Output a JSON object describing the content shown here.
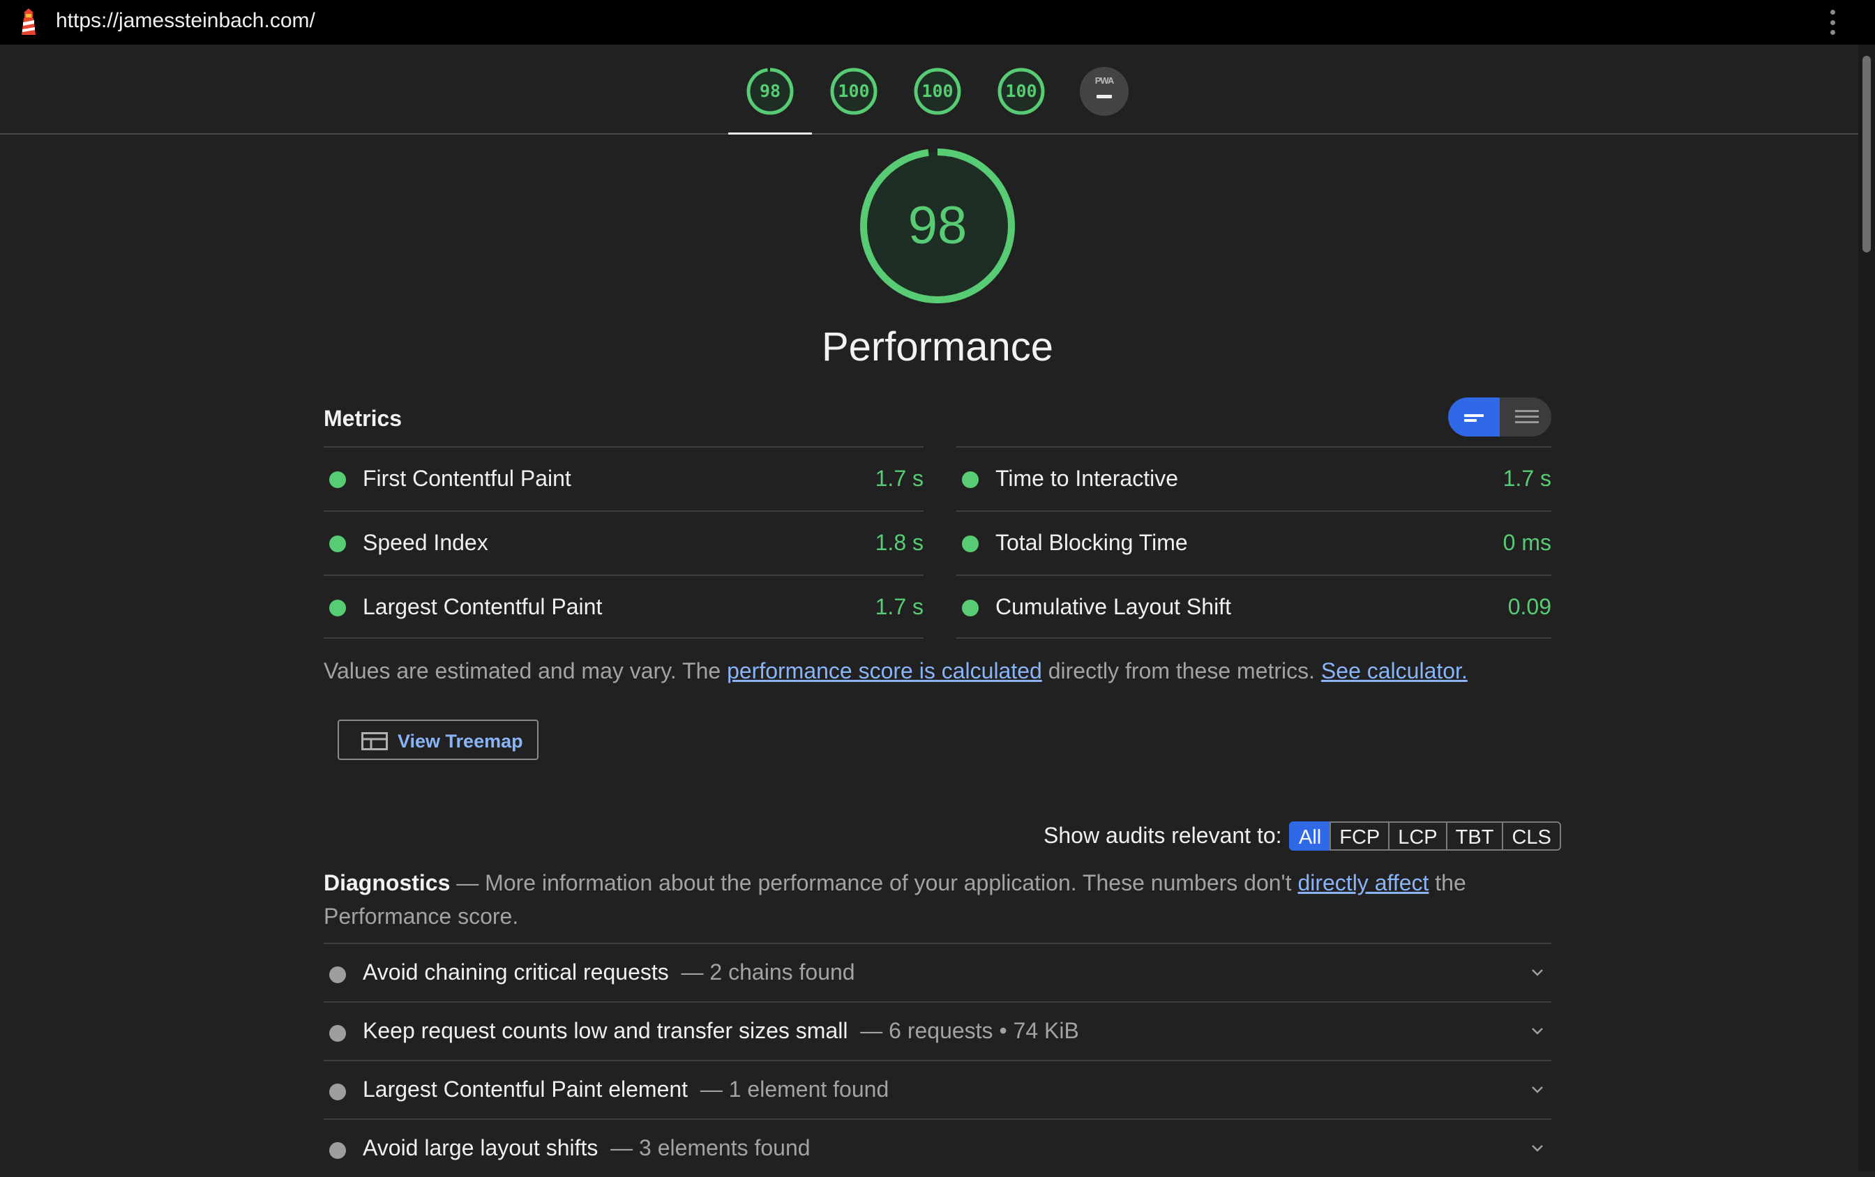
{
  "browser": {
    "url": "https://jamessteinbach.com/"
  },
  "gauges": [
    {
      "score": "98",
      "category": "performance"
    },
    {
      "score": "100",
      "category": "accessibility"
    },
    {
      "score": "100",
      "category": "best-practices"
    },
    {
      "score": "100",
      "category": "seo"
    }
  ],
  "pwa": {
    "label": "PWA"
  },
  "colors": {
    "pass": "#57cc75",
    "accent": "#3069e8",
    "link": "#8ab4f8",
    "background": "#212121"
  },
  "performance": {
    "score": "98",
    "title": "Performance"
  },
  "metrics": {
    "heading": "Metrics",
    "left": [
      {
        "label": "First Contentful Paint",
        "value": "1.7 s"
      },
      {
        "label": "Speed Index",
        "value": "1.8 s"
      },
      {
        "label": "Largest Contentful Paint",
        "value": "1.7 s"
      }
    ],
    "right": [
      {
        "label": "Time to Interactive",
        "value": "1.7 s"
      },
      {
        "label": "Total Blocking Time",
        "value": "0 ms"
      },
      {
        "label": "Cumulative Layout Shift",
        "value": "0.09"
      }
    ],
    "note_prefix": "Values are estimated and may vary. The ",
    "note_link": "performance score is calculated",
    "note_middle": " directly from these metrics. ",
    "note_calc_link": "See calculator."
  },
  "treemap": {
    "label": "View Treemap"
  },
  "filter": {
    "label": "Show audits relevant to:",
    "options": [
      "All",
      "FCP",
      "LCP",
      "TBT",
      "CLS"
    ],
    "selected": "All"
  },
  "diagnostics": {
    "title": "Diagnostics",
    "desc_prefix": " — More information about the performance of your application. These numbers don't ",
    "link": "directly affect",
    "desc_suffix": " the Performance score.",
    "audits": [
      {
        "title": "Avoid chaining critical requests",
        "detail": "2 chains found"
      },
      {
        "title": "Keep request counts low and transfer sizes small",
        "detail": "6 requests • 74 KiB"
      },
      {
        "title": "Largest Contentful Paint element",
        "detail": "1 element found"
      },
      {
        "title": "Avoid large layout shifts",
        "detail": "3 elements found"
      }
    ]
  }
}
